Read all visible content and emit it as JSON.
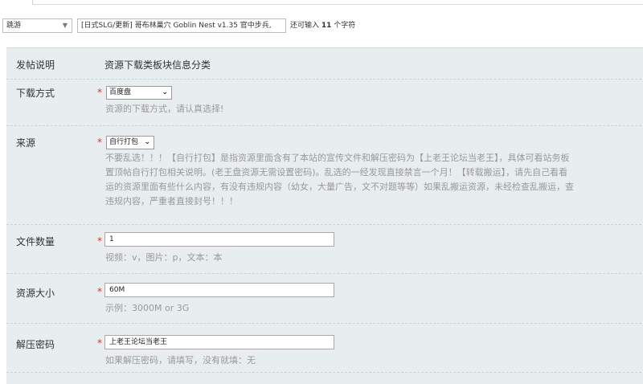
{
  "top": {
    "type_select_value": "跳游",
    "title_value": "[日式SLG/更新] 哥布林巢穴 Goblin Nest v1.35 官中步兵,",
    "char_hint_prefix": "还可输入",
    "char_hint_count": "11",
    "char_hint_suffix": "个字符"
  },
  "form": {
    "intro": {
      "label": "发帖说明",
      "text": "资源下载类板块信息分类"
    },
    "download": {
      "label": "下载方式",
      "required": "*",
      "value": "百度盘",
      "hint": "资源的下载方式，请认真选择!"
    },
    "source": {
      "label": "来源",
      "required": "*",
      "value": "自行打包",
      "hint_lines": [
        "不要乱选！！！【自行打包】是指资源里面含有了本站的宣传文件和解压密码为【上老王论坛当老王】，具体可看站务板",
        "置顶帖自行打包相关说明。(老王盘资源无需设置密码)。乱选的一经发现直接禁言一个月！【转载搬运】，请先自己看看",
        "运的资源里面有些什么内容，有没有违规内容（幼女，大量广告，文不对题等等）如果乱搬运资源，未经检查乱搬运，查",
        "违规内容，严重者直接封号！！！"
      ]
    },
    "file_count": {
      "label": "文件数量",
      "required": "*",
      "value": "1",
      "hint": "视频：v，图片：p，文本：本"
    },
    "size": {
      "label": "资源大小",
      "required": "*",
      "value": "60M",
      "hint": "示例：3000M or 3G"
    },
    "password": {
      "label": "解压密码",
      "required": "*",
      "value": "上老王论坛当老王",
      "hint": "如果解压密码，请填写，没有就填：无"
    }
  }
}
